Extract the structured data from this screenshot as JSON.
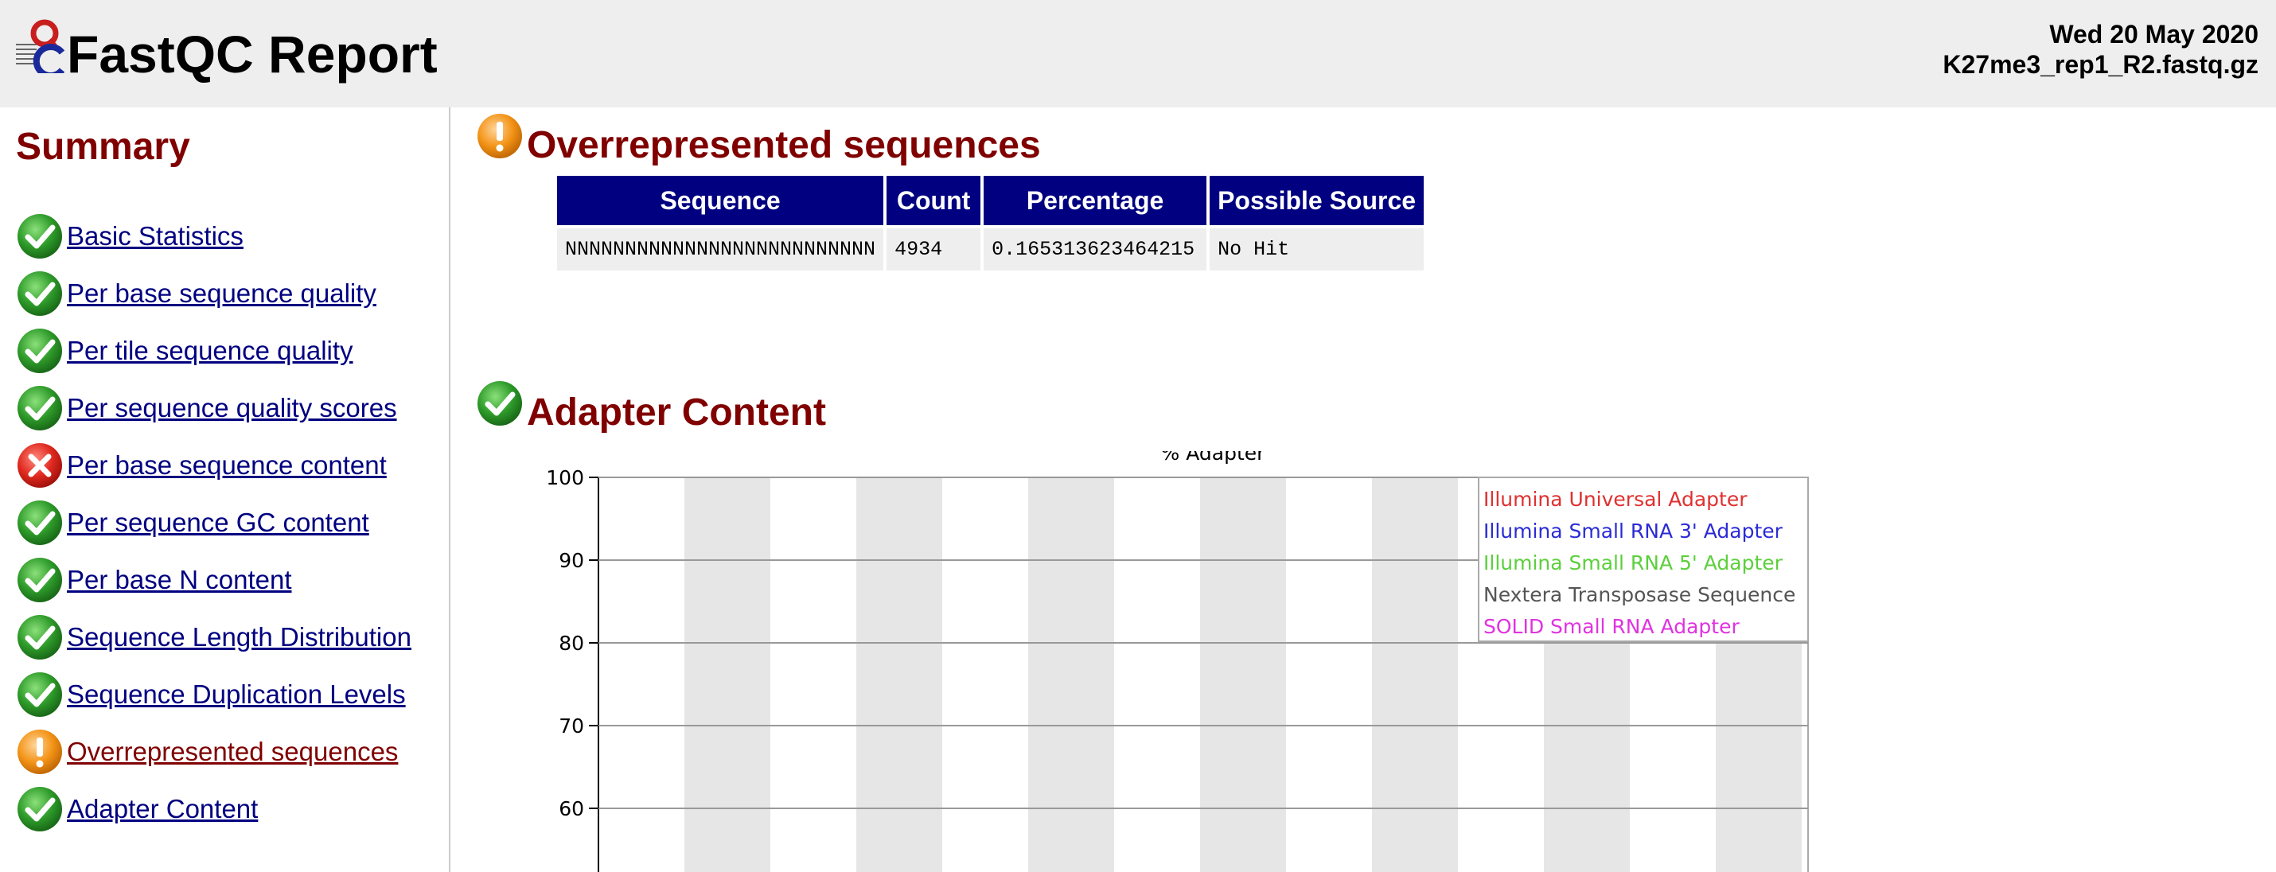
{
  "header": {
    "title": "FastQC Report",
    "date": "Wed 20 May 2020",
    "filename": "K27me3_rep1_R2.fastq.gz"
  },
  "sidebar": {
    "title": "Summary",
    "items": [
      {
        "label": "Basic Statistics",
        "status": "pass"
      },
      {
        "label": "Per base sequence quality",
        "status": "pass"
      },
      {
        "label": "Per tile sequence quality",
        "status": "pass"
      },
      {
        "label": "Per sequence quality scores",
        "status": "pass"
      },
      {
        "label": "Per base sequence content",
        "status": "fail"
      },
      {
        "label": "Per sequence GC content",
        "status": "pass"
      },
      {
        "label": "Per base N content",
        "status": "pass"
      },
      {
        "label": "Sequence Length Distribution",
        "status": "pass"
      },
      {
        "label": "Sequence Duplication Levels",
        "status": "pass"
      },
      {
        "label": "Overrepresented sequences",
        "status": "warn"
      },
      {
        "label": "Adapter Content",
        "status": "pass"
      }
    ]
  },
  "overrepresented": {
    "title": "Overrepresented sequences",
    "status": "warn",
    "table": {
      "headers": [
        "Sequence",
        "Count",
        "Percentage",
        "Possible Source"
      ],
      "rows": [
        [
          "NNNNNNNNNNNNNNNNNNNNNNNNNN",
          "4934",
          "0.165313623464215",
          "No Hit"
        ]
      ]
    }
  },
  "adapter": {
    "title": "Adapter Content",
    "status": "pass"
  },
  "chart_data": {
    "type": "line",
    "title": "% Adapter",
    "ylim": [
      0,
      100
    ],
    "yticks": [
      "100",
      "90",
      "80",
      "70",
      "60"
    ],
    "series": [
      {
        "name": "Illumina Universal Adapter",
        "color": "#e03030"
      },
      {
        "name": "Illumina Small RNA 3' Adapter",
        "color": "#2b2bd6"
      },
      {
        "name": "Illumina Small RNA 5' Adapter",
        "color": "#5ccf3c"
      },
      {
        "name": "Nextera Transposase Sequence",
        "color": "#555555"
      },
      {
        "name": "SOLID Small RNA Adapter",
        "color": "#e033e0"
      }
    ],
    "legend": "top-right",
    "grid": true
  },
  "colors": {
    "header_bg": "#eeeeee",
    "section_title": "#800000",
    "table_header": "#000080",
    "link": "#000080"
  }
}
